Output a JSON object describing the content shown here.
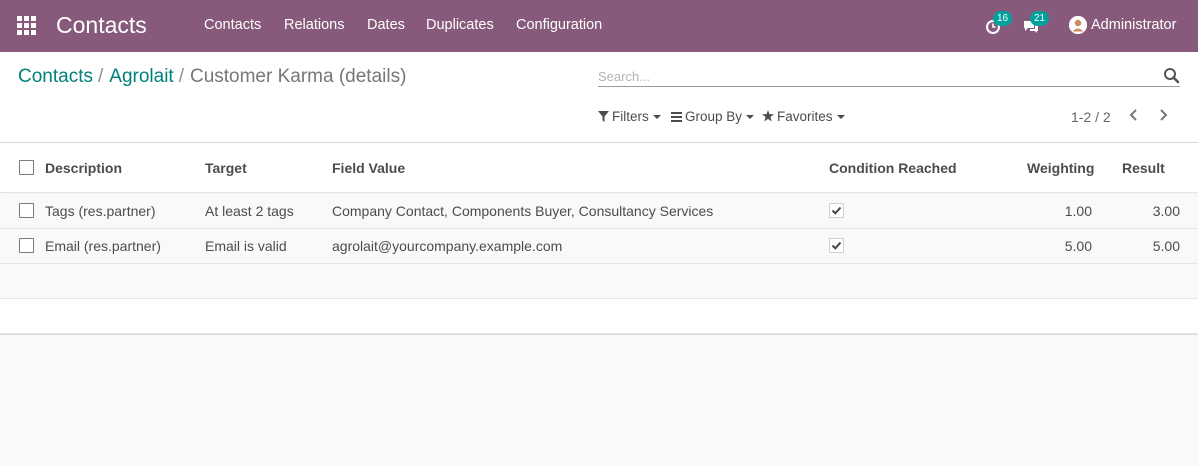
{
  "navbar": {
    "brand": "Contacts",
    "menu": [
      "Contacts",
      "Relations",
      "Dates",
      "Duplicates",
      "Configuration"
    ],
    "activity_count": "16",
    "messages_count": "21",
    "user": "Administrator",
    "color": "#875a7b"
  },
  "breadcrumb": {
    "items": [
      "Contacts",
      "Agrolait"
    ],
    "current": "Customer Karma (details)"
  },
  "search": {
    "placeholder": "Search...",
    "value": ""
  },
  "filters": {
    "filters": "Filters",
    "group_by": "Group By",
    "favorites": "Favorites"
  },
  "pager": {
    "value": "1-2 / 2"
  },
  "table": {
    "columns": [
      "Description",
      "Target",
      "Field Value",
      "Condition Reached",
      "Weighting",
      "Result"
    ],
    "rows": [
      {
        "description": "Tags (res.partner)",
        "target": "At least 2 tags",
        "field_value": "Company Contact, Components Buyer, Consultancy Services",
        "condition_reached": true,
        "weighting": "1.00",
        "result": "3.00"
      },
      {
        "description": "Email (res.partner)",
        "target": "Email is valid",
        "field_value": "agrolait@yourcompany.example.com",
        "condition_reached": true,
        "weighting": "5.00",
        "result": "5.00"
      }
    ]
  },
  "icons": {
    "apps": "apps-grid-icon",
    "activity": "clock-icon",
    "messages": "chat-icon",
    "search": "search-icon",
    "filter": "filter-icon",
    "group": "list-icon",
    "favorite": "star-icon",
    "prev": "chevron-left-icon",
    "next": "chevron-right-icon"
  },
  "colors": {
    "link": "#00807d",
    "badge": "#00a09d"
  }
}
